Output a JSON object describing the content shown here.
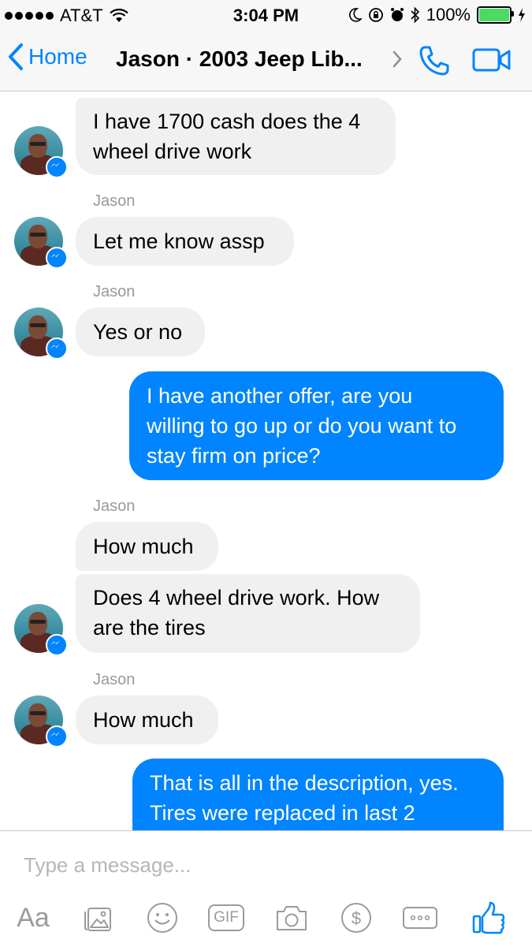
{
  "status_bar": {
    "carrier": "AT&T",
    "time": "3:04 PM",
    "battery": "100%"
  },
  "nav": {
    "back_label": "Home",
    "title": "Jason · 2003 Jeep Lib..."
  },
  "messages": [
    {
      "text_lines": [
        "I have 1700 cash does the 4",
        "wheel drive work"
      ]
    },
    {
      "sender": "Jason",
      "text": "Let me know assp"
    },
    {
      "sender": "Jason",
      "text": "Yes or no"
    },
    {
      "text_lines": [
        "I have another offer, are you",
        "willing to go up or do you want to",
        "stay firm on price?"
      ]
    },
    {
      "sender": "Jason",
      "text": "How much"
    },
    {
      "text_lines": [
        "Does 4 wheel drive work. How",
        "are the tires"
      ]
    },
    {
      "sender": "Jason",
      "text": "How much"
    },
    {
      "text_lines": [
        "That is all in the description, yes.",
        "Tires were replaced in last 2"
      ]
    }
  ],
  "composer": {
    "placeholder": "Type a message...",
    "tools": {
      "text": "Aa",
      "gif": "GIF"
    }
  },
  "colors": {
    "accent": "#0084ff",
    "incoming_bubble": "#f0f0f0"
  }
}
